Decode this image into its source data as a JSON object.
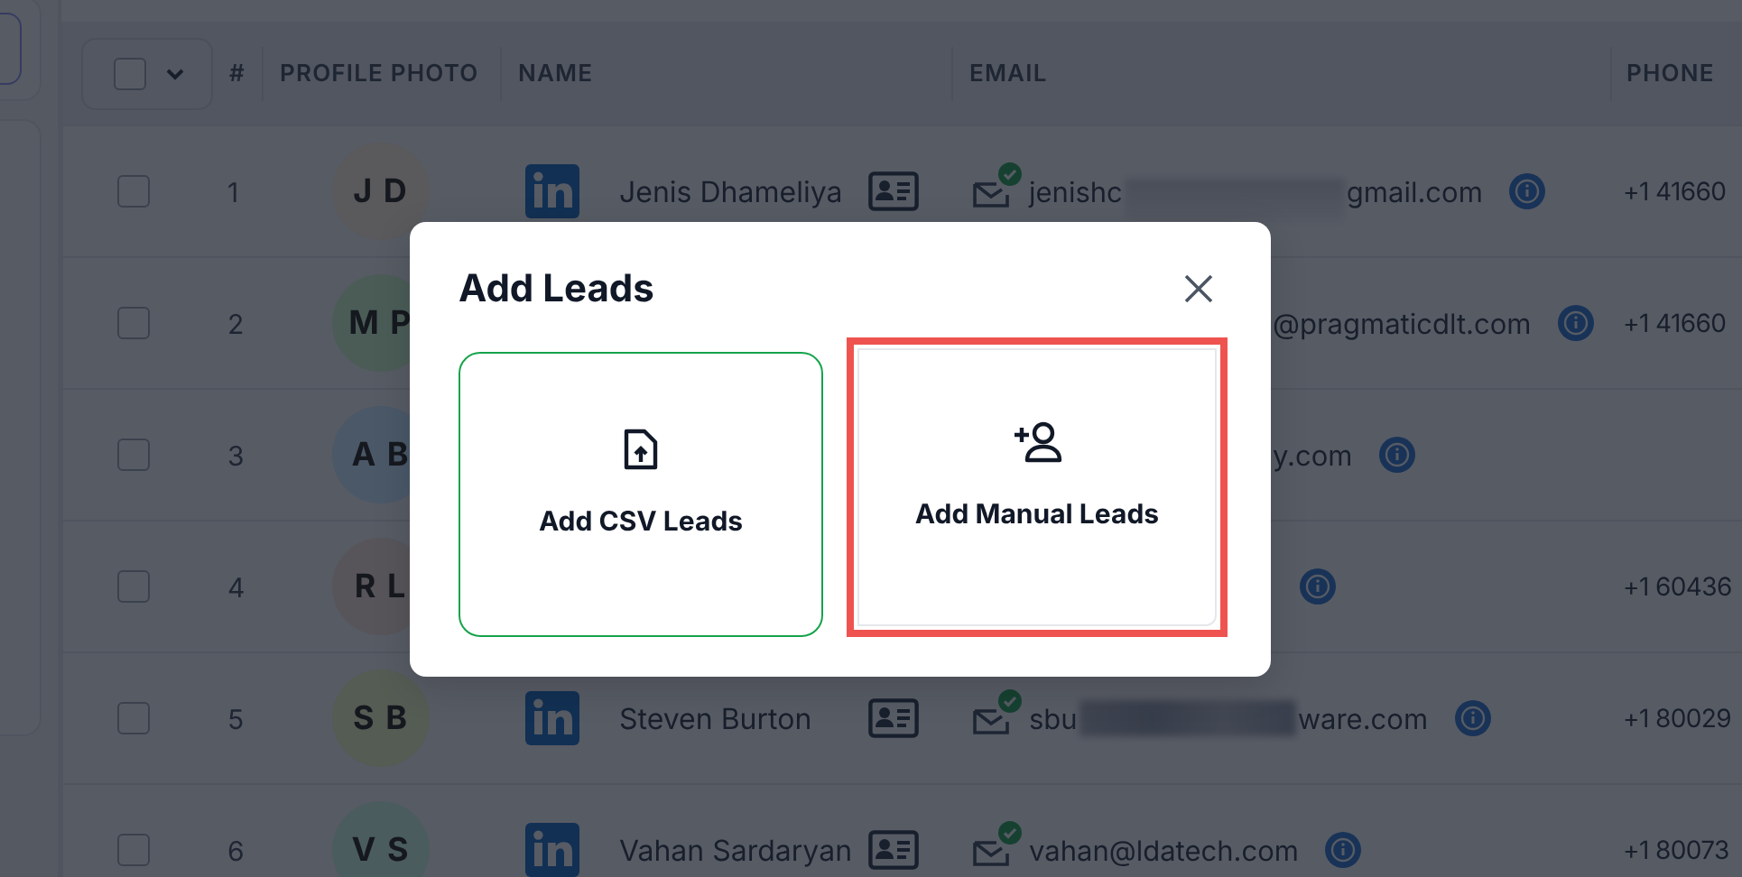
{
  "table": {
    "header_select": {
      "checked": false
    },
    "columns": [
      "#",
      "PROFILE PHOTO",
      "NAME",
      "EMAIL",
      "PHONE"
    ],
    "rows": [
      {
        "kind": "full",
        "checked": false,
        "number": "1",
        "initials": "J D",
        "color": "#5a595b",
        "name": "Jenis Dhameliya",
        "verified": true,
        "email_parts": [
          "jenishc",
          "gmail.com"
        ],
        "phone": "+1 41660"
      },
      {
        "kind": "partly_hidden",
        "checked": false,
        "number": "2",
        "initials": "M P",
        "color": "#4b5c57",
        "email_parts": [
          "@pragmaticdlt.com"
        ],
        "phone": "+1 41660"
      },
      {
        "kind": "partly_hidden",
        "checked": false,
        "number": "3",
        "initials": "A B",
        "color": "#4a5868",
        "email_parts": [
          "y.com"
        ]
      },
      {
        "kind": "partly_hidden",
        "checked": false,
        "number": "4",
        "initials": "R L",
        "color": "#57555a",
        "phone": "+1 60436"
      },
      {
        "kind": "full",
        "checked": false,
        "number": "5",
        "initials": "S B",
        "color": "#545c54",
        "name": "Steven Burton",
        "verified": true,
        "email_parts": [
          "sbu",
          "ware.com"
        ],
        "phone": "+1 80029"
      },
      {
        "kind": "full",
        "checked": false,
        "number": "6",
        "initials": "V S",
        "color": "#4b5c5e",
        "name": "Vahan Sardaryan",
        "verified": true,
        "email_parts": [
          "vahan@ldatech.com"
        ],
        "phone": "+1 80073"
      }
    ]
  },
  "dialog": {
    "title": "Add Leads",
    "options": [
      {
        "kind": "csv",
        "label": "Add CSV Leads",
        "selected": true,
        "highlighted": false
      },
      {
        "kind": "manual",
        "label": "Add Manual Leads",
        "selected": false,
        "highlighted": true
      }
    ]
  }
}
